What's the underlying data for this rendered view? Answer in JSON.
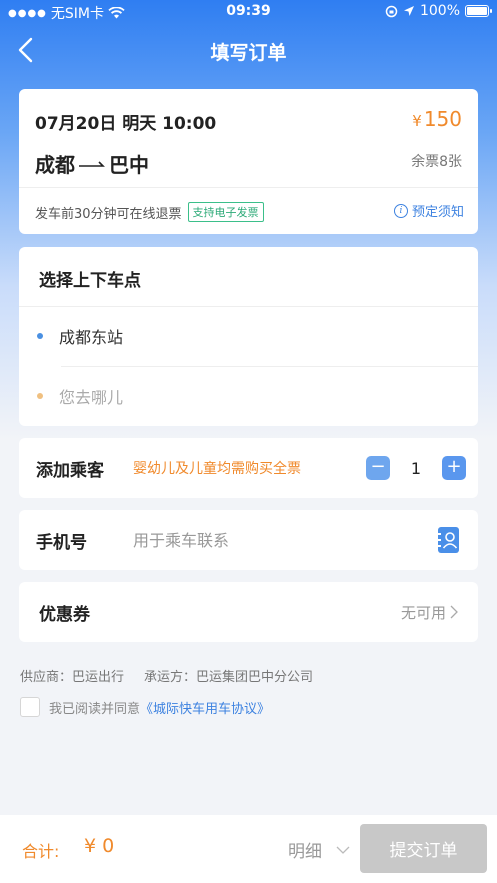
{
  "status_bar": {
    "carrier": "无SIM卡",
    "time": "09:39",
    "battery": "100%"
  },
  "nav": {
    "title": "填写订单",
    "back_icon": "chevron-left-icon"
  },
  "trip": {
    "date_time": "07月20日 明天 10:00",
    "price_symbol": "¥",
    "price": "150",
    "origin": "成都",
    "destination": "巴中",
    "seats_left": "余票8张",
    "refund_policy": "发车前30分钟可在线退票",
    "invoice_tag": "支持电子发票",
    "notice_link": "预定须知"
  },
  "stops": {
    "title": "选择上下车点",
    "boarding": "成都东站",
    "alighting_placeholder": "您去哪儿",
    "boarding_dot_color": "#4a90e2",
    "alighting_dot_color": "#f0c080"
  },
  "passenger": {
    "label": "添加乘客",
    "hint": "婴幼儿及儿童均需购买全票",
    "count": "1",
    "minus": "−",
    "plus": "+"
  },
  "phone": {
    "label": "手机号",
    "placeholder": "用于乘车联系",
    "value": ""
  },
  "coupon": {
    "label": "优惠券",
    "value": "无可用"
  },
  "footer_info": {
    "supplier": "供应商：巴运出行",
    "carrier": "承运方：巴运集团巴中分公司",
    "agree_prefix": "我已阅读并同意",
    "agree_link": "《城际快车用车协议》"
  },
  "bottom_bar": {
    "total_label": "合计:",
    "total_amount": "¥ 0",
    "detail": "明细",
    "submit": "提交订单"
  },
  "colors": {
    "accent_blue": "#3d82e0",
    "price_orange": "#f08a2c",
    "disabled_gray": "#c8c8c8"
  }
}
